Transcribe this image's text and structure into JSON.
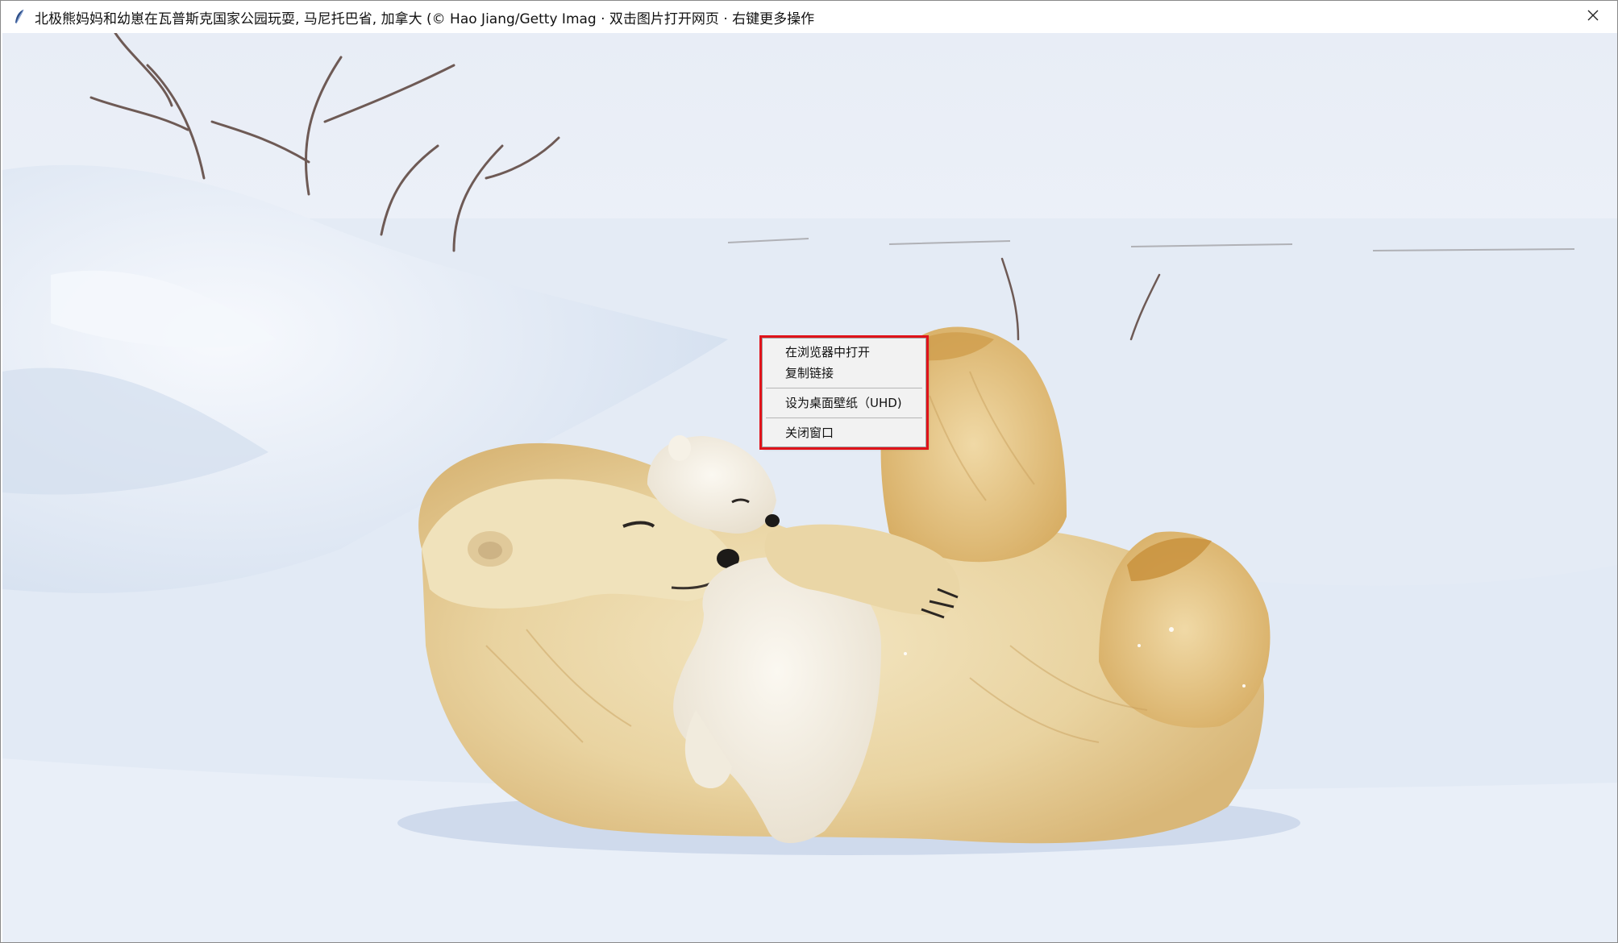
{
  "window": {
    "title": "北极熊妈妈和幼崽在瓦普斯克国家公园玩耍, 马尼托巴省, 加拿大 (© Hao Jiang/Getty Imag · 双击图片打开网页 · 右键更多操作",
    "title_icon": "feather-icon",
    "close_icon": "close-icon"
  },
  "image": {
    "subject": "polar-bear-photo"
  },
  "context_menu": {
    "items": [
      {
        "label": "在浏览器中打开"
      },
      {
        "label": "复制链接"
      },
      {
        "label": "设为桌面壁纸（UHD)"
      },
      {
        "label": "关闭窗口"
      }
    ],
    "highlight_color": "#e0131a"
  }
}
